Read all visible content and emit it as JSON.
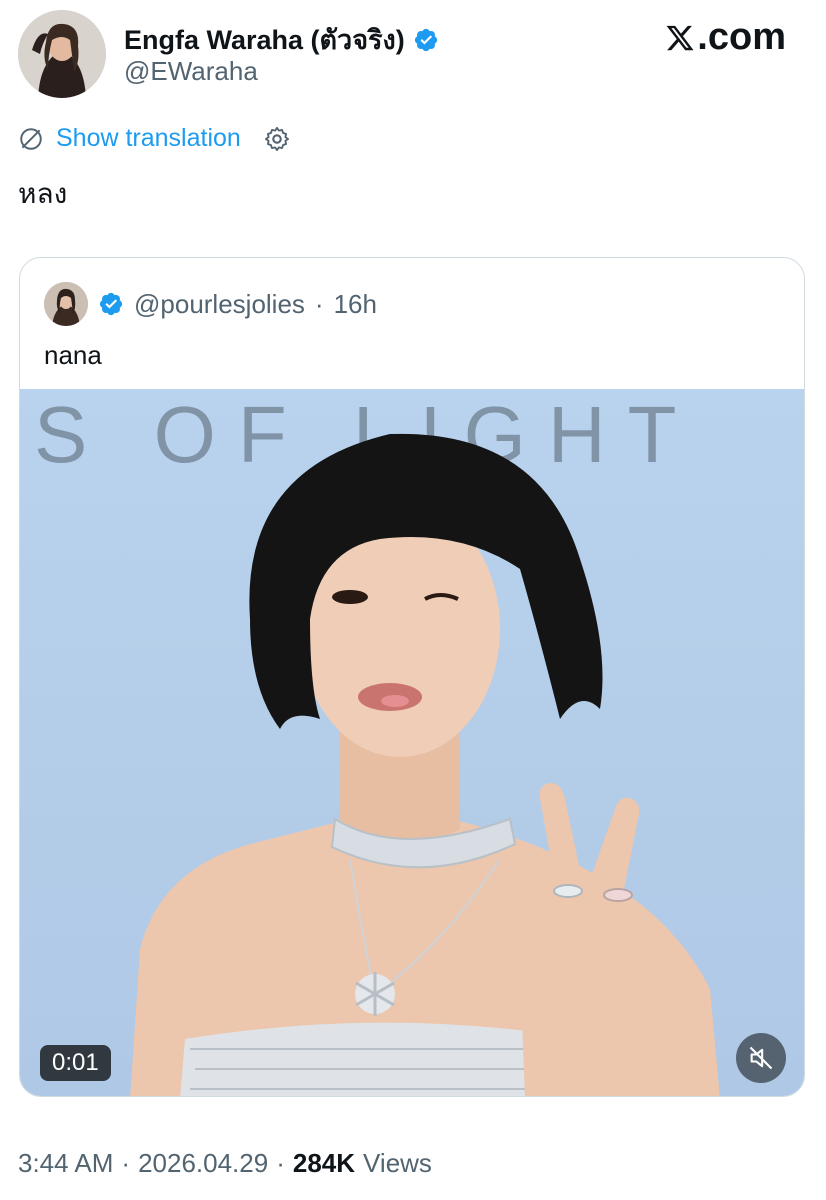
{
  "author": {
    "name": "Engfa Waraha (ตัวจริง)",
    "handle": "@EWaraha",
    "verified": true
  },
  "brand": {
    "logo_text": ".com"
  },
  "translation": {
    "label": "Show translation"
  },
  "tweet": {
    "text": "หลง"
  },
  "quote": {
    "handle": "@pourlesjolies",
    "separator": "·",
    "time": "16h",
    "text": "nana",
    "media": {
      "backdrop_text": "S OF LIGHT",
      "duration": "0:01"
    }
  },
  "meta": {
    "time": "3:44 AM",
    "sep1": "·",
    "date": "2026.04.29",
    "sep2": "·",
    "views_count": "284K",
    "views_label": "Views"
  },
  "colors": {
    "accent": "#1d9bf0",
    "text": "#0f1419",
    "muted": "#536471",
    "border": "#cfd9de"
  }
}
